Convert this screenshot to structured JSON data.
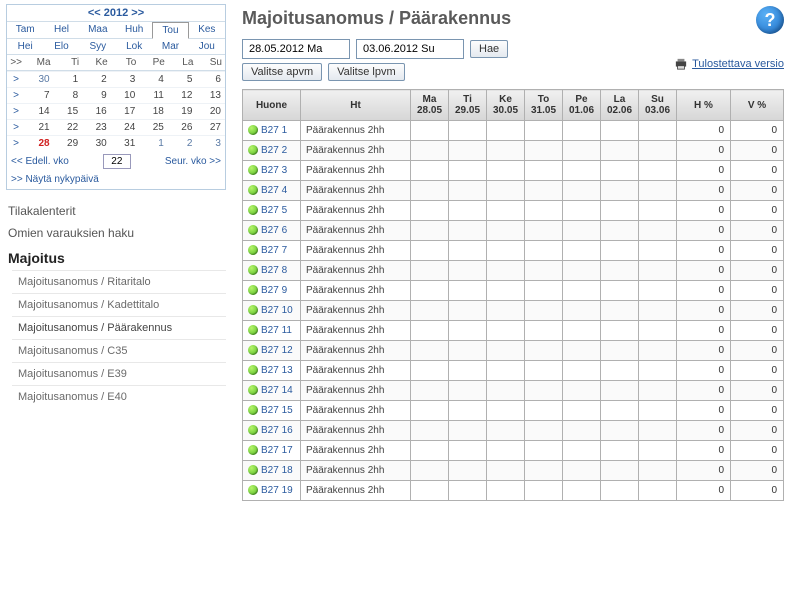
{
  "calendar": {
    "year": "2012",
    "prev": "<<",
    "next": ">>",
    "months_row1": [
      "Tam",
      "Hel",
      "Maa",
      "Huh",
      "Tou",
      "Kes"
    ],
    "months_row2": [
      "Hei",
      "Elo",
      "Syy",
      "Lok",
      "Mar",
      "Jou"
    ],
    "current_month": "Tou",
    "dow": [
      ">>",
      "Ma",
      "Ti",
      "Ke",
      "To",
      "Pe",
      "La",
      "Su"
    ],
    "weeks": [
      {
        "wk": ">",
        "d": [
          "30",
          "1",
          "2",
          "3",
          "4",
          "5",
          "6"
        ],
        "other": [
          0
        ]
      },
      {
        "wk": ">",
        "d": [
          "7",
          "8",
          "9",
          "10",
          "11",
          "12",
          "13"
        ]
      },
      {
        "wk": ">",
        "d": [
          "14",
          "15",
          "16",
          "17",
          "18",
          "19",
          "20"
        ]
      },
      {
        "wk": ">",
        "d": [
          "21",
          "22",
          "23",
          "24",
          "25",
          "26",
          "27"
        ]
      },
      {
        "wk": ">",
        "d": [
          "28",
          "29",
          "30",
          "31",
          "1",
          "2",
          "3"
        ],
        "today": 0,
        "other": [
          4,
          5,
          6
        ]
      }
    ],
    "prev_week": "<< Edell. vko",
    "week_input": "22",
    "next_week": "Seur. vko >>",
    "show_today": ">> Näytä nykypäivä"
  },
  "sidebar": {
    "tilakalenterit": "Tilakalenterit",
    "omien": "Omien varauksien haku",
    "majoitus": "Majoitus",
    "items": [
      "Majoitusanomus / Ritaritalo",
      "Majoitusanomus / Kadettitalo",
      "Majoitusanomus / Päärakennus",
      "Majoitusanomus / C35",
      "Majoitusanomus / E39",
      "Majoitusanomus / E40"
    ]
  },
  "page": {
    "title": "Majoitusanomus / Päärakennus",
    "date_from": "28.05.2012 Ma",
    "date_to": "03.06.2012 Su",
    "hae": "Hae",
    "valitse_apvm": "Valitse apvm",
    "valitse_lpvm": "Valitse lpvm",
    "print": "Tulostettava versio"
  },
  "table": {
    "headers": {
      "huone": "Huone",
      "ht": "Ht",
      "days": [
        {
          "d": "Ma",
          "date": "28.05"
        },
        {
          "d": "Ti",
          "date": "29.05"
        },
        {
          "d": "Ke",
          "date": "30.05"
        },
        {
          "d": "To",
          "date": "31.05"
        },
        {
          "d": "Pe",
          "date": "01.06"
        },
        {
          "d": "La",
          "date": "02.06"
        },
        {
          "d": "Su",
          "date": "03.06"
        }
      ],
      "hpct": "H %",
      "vpct": "V %"
    },
    "ht_value": "Päärakennus 2hh",
    "rooms": [
      "B27 1",
      "B27 2",
      "B27 3",
      "B27 4",
      "B27 5",
      "B27 6",
      "B27 7",
      "B27 8",
      "B27 9",
      "B27 10",
      "B27 11",
      "B27 12",
      "B27 13",
      "B27 14",
      "B27 15",
      "B27 16",
      "B27 17",
      "B27 18",
      "B27 19"
    ],
    "zero": "0"
  }
}
